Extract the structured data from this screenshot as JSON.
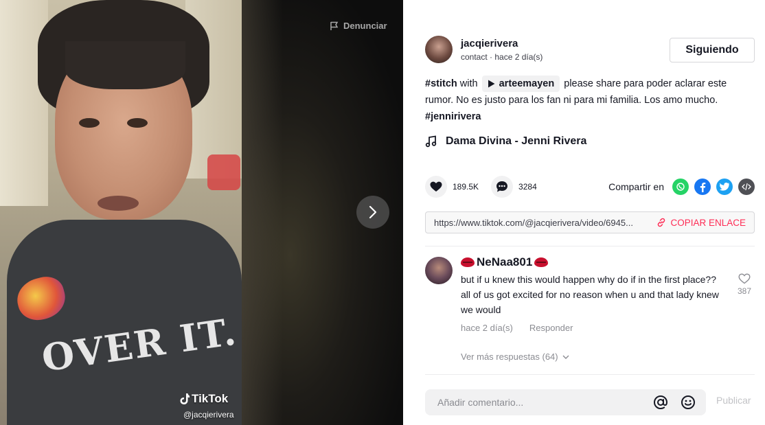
{
  "video": {
    "report_label": "Denunciar",
    "watermark_brand": "TikTok",
    "watermark_handle": "@jacqierivera",
    "shirt_text": "OVER IT."
  },
  "author": {
    "username": "jacqierivera",
    "meta": "contact · hace 2 día(s)",
    "follow_label": "Siguiendo"
  },
  "description": {
    "stitch_tag": "#stitch",
    "with_word": "with",
    "stitch_user": "arteemayen",
    "text": "please share para poder aclarar este rumor. No es justo para los fan ni para mi familia. Los amo mucho.",
    "hashtag": "#jennirivera"
  },
  "music": {
    "title": "Dama Divina - Jenni Rivera"
  },
  "actions": {
    "likes": "189.5K",
    "comments": "3284",
    "share_label": "Compartir en"
  },
  "link": {
    "url": "https://www.tiktok.com/@jacqierivera/video/6945...",
    "copy_label": "COPIAR ENLACE"
  },
  "comment": {
    "username": "NeNaa801",
    "text": "but if u knew this would happen why do if in the first place?? all of us got excited for no reason when u and that lady knew we would",
    "time": "hace 2 día(s)",
    "reply_label": "Responder",
    "likes": "387",
    "more_replies": "Ver más respuestas (64)"
  },
  "composer": {
    "placeholder": "Añadir comentario...",
    "post_label": "Publicar"
  },
  "colors": {
    "accent": "#fe2c55",
    "whatsapp": "#25d366",
    "facebook": "#1877f2",
    "twitter": "#1da1f2",
    "embed": "#4f5055"
  }
}
